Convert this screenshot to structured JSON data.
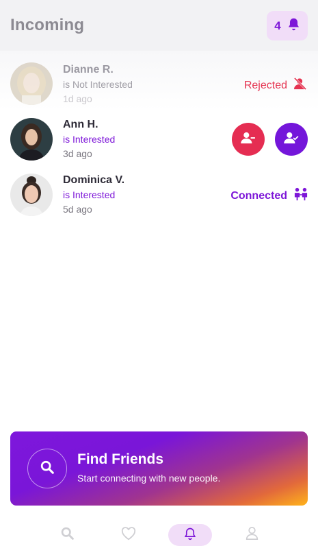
{
  "header": {
    "title": "Incoming",
    "notification_count": "4"
  },
  "requests": [
    {
      "name": "Dianne R.",
      "status": "is Not Interested",
      "time": "1d ago",
      "state_label": "Rejected"
    },
    {
      "name": "Ann H.",
      "status": "is Interested",
      "time": "3d ago"
    },
    {
      "name": "Dominica V.",
      "status": "is Interested",
      "time": "5d ago",
      "state_label": "Connected"
    }
  ],
  "promo": {
    "title": "Find Friends",
    "subtitle": "Start connecting with new people."
  },
  "tabbar": {
    "items": [
      "search-icon",
      "heart-icon",
      "bell-icon",
      "user-icon"
    ],
    "active": "bell-icon"
  },
  "colors": {
    "accent": "#7d16d8",
    "danger": "#e52d52",
    "badge_bg": "#f1ddf8"
  }
}
